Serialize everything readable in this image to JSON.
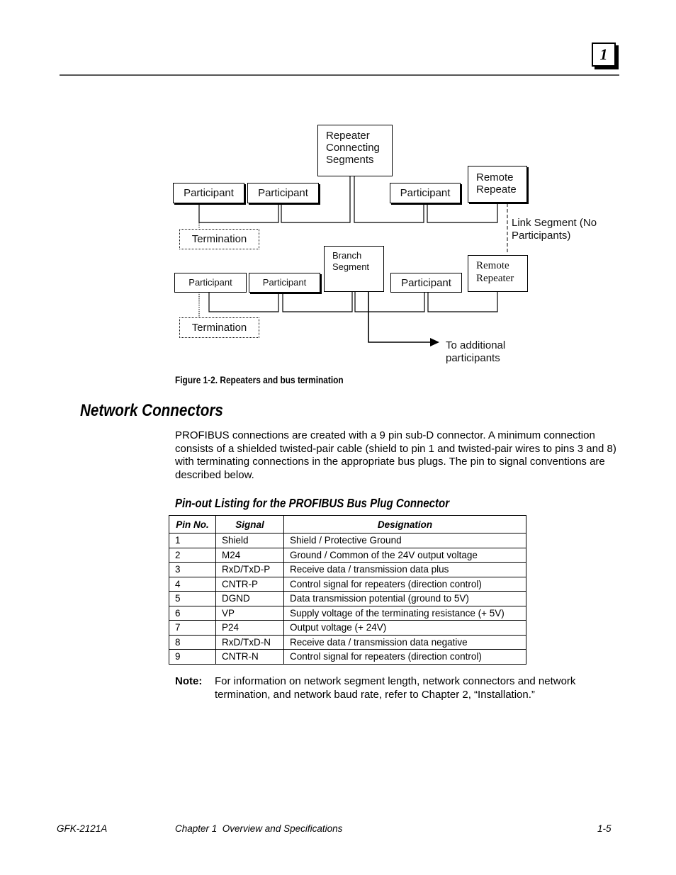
{
  "header": {
    "chapter_number": "1"
  },
  "diagram": {
    "repeater_connecting": "Repeater Connecting Segments",
    "remote_repeater_top": "Remote Repeate",
    "remote_repeater_bottom": "Remote Repeater",
    "branch_segment": "Branch Segment",
    "participant": "Participant",
    "termination": "Termination",
    "link_segment": "Link Segment (No Participants)",
    "additional": "To additional participants"
  },
  "figure_caption": "Figure 1-2. Repeaters and bus termination",
  "section": {
    "title": "Network Connectors",
    "paragraph": "PROFIBUS connections are created with a 9 pin sub-D connector. A minimum connection consists of a shielded twisted-pair cable (shield to pin 1 and twisted-pair wires to pins 3 and 8) with terminating connections in the appropriate bus plugs. The pin to signal conventions are described below."
  },
  "table": {
    "title": "Pin-out Listing for the PROFIBUS Bus Plug Connector",
    "headers": [
      "Pin No.",
      "Signal",
      "Designation"
    ],
    "rows": [
      [
        "1",
        "Shield",
        "Shield / Protective Ground"
      ],
      [
        "2",
        "M24",
        "Ground / Common of the 24V output voltage"
      ],
      [
        "3",
        "RxD/TxD-P",
        "Receive data / transmission data plus"
      ],
      [
        "4",
        "CNTR-P",
        "Control signal for repeaters (direction control)"
      ],
      [
        "5",
        "DGND",
        "Data transmission potential (ground to 5V)"
      ],
      [
        "6",
        "VP",
        "Supply voltage of the terminating resistance (+ 5V)"
      ],
      [
        "7",
        "P24",
        "Output voltage (+ 24V)"
      ],
      [
        "8",
        "RxD/TxD-N",
        "Receive data / transmission data negative"
      ],
      [
        "9",
        "CNTR-N",
        "Control signal for repeaters (direction control)"
      ]
    ]
  },
  "note": {
    "label": "Note:",
    "text": "For information on network segment length, network connectors and network termination, and network baud rate, refer to Chapter 2, “Installation.”"
  },
  "footer": {
    "doc_number": "GFK-2121A",
    "chapter": "Chapter 1  Overview and Specifications",
    "page": "1-5"
  }
}
